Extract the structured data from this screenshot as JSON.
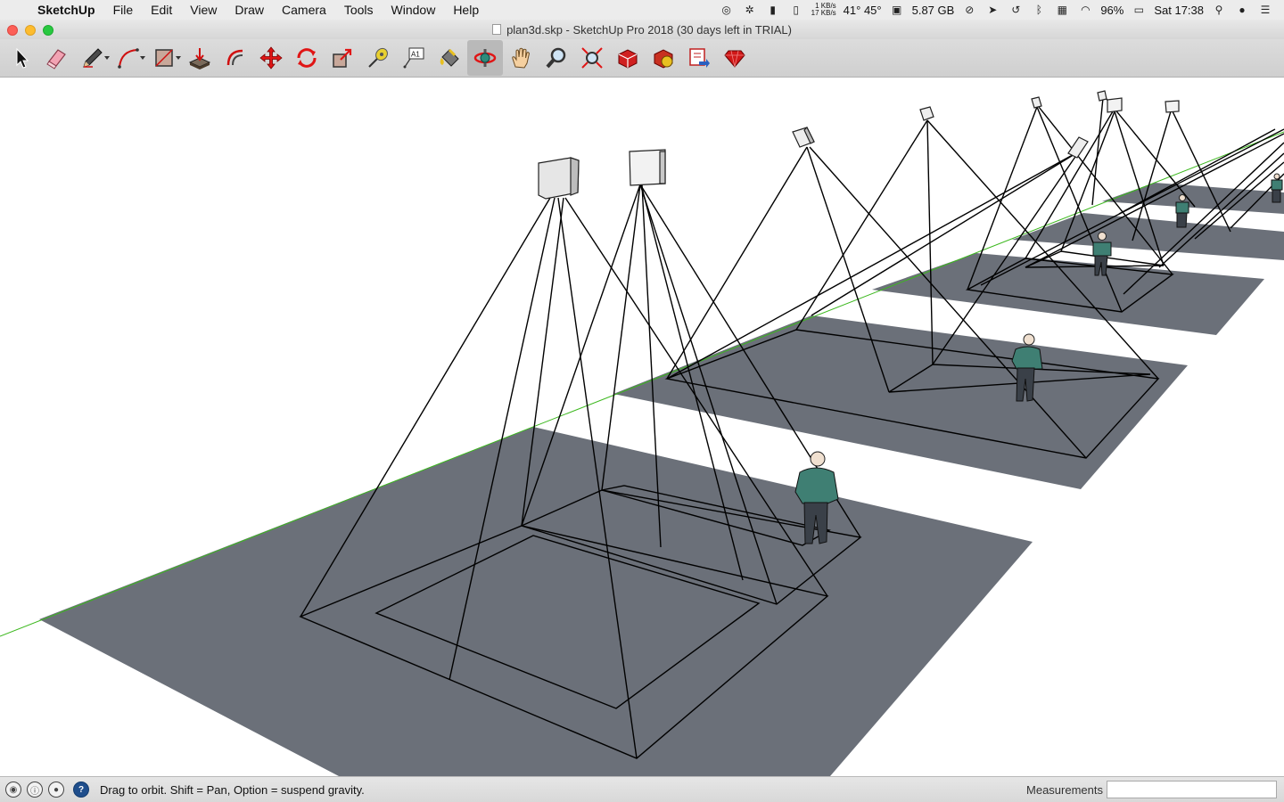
{
  "menubar": {
    "app_name": "SketchUp",
    "items": [
      "File",
      "Edit",
      "View",
      "Draw",
      "Camera",
      "Tools",
      "Window",
      "Help"
    ],
    "net_up": "1 KB/s",
    "net_down": "17 KB/s",
    "temps": "41° 45°",
    "memory": "5.87 GB",
    "battery": "96%",
    "clock": "Sat 17:38"
  },
  "window": {
    "title": "plan3d.skp - SketchUp Pro 2018 (30 days left in TRIAL)"
  },
  "toolbar": {
    "tools": [
      {
        "name": "select-tool",
        "icon": "arrow-cursor-icon"
      },
      {
        "name": "eraser-tool",
        "icon": "eraser-icon"
      },
      {
        "name": "line-tool",
        "icon": "pencil-icon",
        "dropdown": true
      },
      {
        "name": "arc-tool",
        "icon": "arc-icon",
        "dropdown": true
      },
      {
        "name": "shape-tool",
        "icon": "rectangle-icon",
        "dropdown": true
      },
      {
        "name": "push-pull-tool",
        "icon": "push-pull-icon"
      },
      {
        "name": "offset-tool",
        "icon": "offset-icon"
      },
      {
        "name": "move-tool",
        "icon": "move-icon"
      },
      {
        "name": "rotate-tool",
        "icon": "rotate-icon"
      },
      {
        "name": "scale-tool",
        "icon": "scale-icon"
      },
      {
        "name": "tape-measure-tool",
        "icon": "tape-measure-icon"
      },
      {
        "name": "text-tool",
        "icon": "text-icon"
      },
      {
        "name": "paint-bucket-tool",
        "icon": "paint-bucket-icon"
      },
      {
        "name": "orbit-tool",
        "icon": "orbit-icon",
        "active": true
      },
      {
        "name": "pan-tool",
        "icon": "hand-icon"
      },
      {
        "name": "zoom-tool",
        "icon": "magnifier-icon"
      },
      {
        "name": "zoom-extents-tool",
        "icon": "zoom-extents-icon"
      },
      {
        "name": "3d-warehouse-tool",
        "icon": "warehouse-icon"
      },
      {
        "name": "extension-warehouse-tool",
        "icon": "extension-icon"
      },
      {
        "name": "send-to-layout-tool",
        "icon": "layout-icon"
      },
      {
        "name": "extension-manager-tool",
        "icon": "ruby-gem-icon"
      }
    ],
    "text_tool_glyph": "A1"
  },
  "status": {
    "hint": "Drag to orbit. Shift = Pan, Option = suspend gravity.",
    "measurements_label": "Measurements",
    "measurements_value": ""
  },
  "colors": {
    "ground_plane": "#6b7079",
    "green_axis": "#3cb81e",
    "edges": "#000000"
  }
}
